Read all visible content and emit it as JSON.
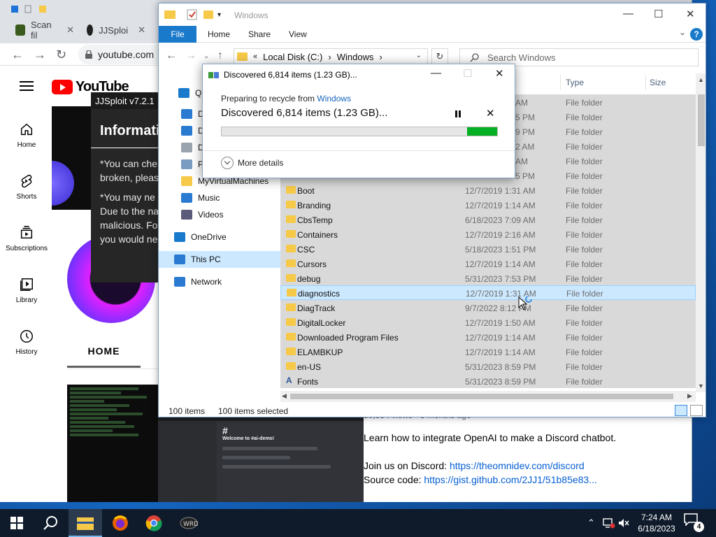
{
  "browser": {
    "tabs": [
      {
        "label": "Scan fil",
        "favicon_color": "#3a5a1e"
      },
      {
        "label": "JJSploi",
        "favicon_color": "#222222"
      }
    ],
    "url": "youtube.com"
  },
  "youtube": {
    "logo_text": "YouTube",
    "sidebar": [
      {
        "label": "Home",
        "icon": "home-icon"
      },
      {
        "label": "Shorts",
        "icon": "shorts-icon"
      },
      {
        "label": "Subscriptions",
        "icon": "subscriptions-icon"
      },
      {
        "label": "Library",
        "icon": "library-icon"
      },
      {
        "label": "History",
        "icon": "history-icon"
      }
    ],
    "channel_tab": "HOME",
    "video": {
      "views": "30,554 views • 3 months ago",
      "description": "Learn how to integrate OpenAI to make a Discord chatbot.",
      "discord_prefix": "Join us on Discord: ",
      "discord_link": "https://theomnidev.com/discord",
      "source_prefix": "Source code: ",
      "source_link": "https://gist.github.com/2JJ1/51b85e83...",
      "thumbnail_channel": "Welcome to #ai-demo!"
    }
  },
  "jjsploit": {
    "title": "JJSploit v7.2.1",
    "heading": "Information",
    "line1a": "*You can che",
    "line1b": "broken, pleas",
    "line2a": "*You may ne",
    "line2b": "Due to the na",
    "line2c": "malicious. Fo",
    "line2d": "you would ne"
  },
  "explorer": {
    "title": "Windows",
    "ribbon": {
      "file": "File",
      "home": "Home",
      "share": "Share",
      "view": "View",
      "help": "?"
    },
    "address": {
      "root": "Local Disk (C:)",
      "folder": "Windows",
      "sep": "›"
    },
    "search_placeholder": "Search Windows",
    "columns": {
      "type": "Type",
      "size": "Size"
    },
    "nav": [
      {
        "label": "Quick access",
        "icon": "star-icon",
        "color": "#1979ca"
      },
      {
        "label": "Desktop",
        "icon": "desktop-icon",
        "color": "#2a7ad2"
      },
      {
        "label": "Downloads",
        "icon": "download-icon",
        "color": "#2a7ad2"
      },
      {
        "label": "Documents",
        "icon": "documents-icon",
        "color": "#9aa4ae"
      },
      {
        "label": "Pictures",
        "icon": "pictures-icon",
        "color": "#7a9cc0"
      },
      {
        "label": "MyVirtualMachines",
        "icon": "folder-icon",
        "color": "#f7c948"
      },
      {
        "label": "Music",
        "icon": "music-icon",
        "color": "#2a7ad2"
      },
      {
        "label": "Videos",
        "icon": "videos-icon",
        "color": "#5a5a7a"
      },
      {
        "label": "OneDrive",
        "icon": "onedrive-icon",
        "color": "#1979ca"
      },
      {
        "label": "This PC",
        "icon": "this-pc-icon",
        "color": "#2a7ad2"
      },
      {
        "label": "Network",
        "icon": "network-icon",
        "color": "#2a7ad2"
      }
    ],
    "hidden_rows": [
      {
        "date": "AM",
        "type": "File folder"
      },
      {
        "date": "5 PM",
        "type": "File folder"
      },
      {
        "date": "9 PM",
        "type": "File folder"
      },
      {
        "date": "2 AM",
        "type": "File folder"
      },
      {
        "date": "AM",
        "type": "File folder"
      },
      {
        "date": "5 PM",
        "type": "File folder"
      }
    ],
    "rows": [
      {
        "name": "Boot",
        "date": "12/7/2019 1:31 AM",
        "type": "File folder"
      },
      {
        "name": "Branding",
        "date": "12/7/2019 1:14 AM",
        "type": "File folder"
      },
      {
        "name": "CbsTemp",
        "date": "6/18/2023 7:09 AM",
        "type": "File folder"
      },
      {
        "name": "Containers",
        "date": "12/7/2019 2:16 AM",
        "type": "File folder"
      },
      {
        "name": "CSC",
        "date": "5/18/2023 1:51 PM",
        "type": "File folder"
      },
      {
        "name": "Cursors",
        "date": "12/7/2019 1:14 AM",
        "type": "File folder"
      },
      {
        "name": "debug",
        "date": "5/31/2023 7:53 PM",
        "type": "File folder"
      },
      {
        "name": "diagnostics",
        "date": "12/7/2019 1:31 AM",
        "type": "File folder",
        "focus": true
      },
      {
        "name": "DiagTrack",
        "date": "9/7/2022 8:12 PM",
        "type": "File folder"
      },
      {
        "name": "DigitalLocker",
        "date": "12/7/2019 1:50 AM",
        "type": "File folder"
      },
      {
        "name": "Downloaded Program Files",
        "date": "12/7/2019 1:14 AM",
        "type": "File folder"
      },
      {
        "name": "ELAMBKUP",
        "date": "12/7/2019 1:14 AM",
        "type": "File folder"
      },
      {
        "name": "en-US",
        "date": "5/31/2023 8:59 PM",
        "type": "File folder"
      },
      {
        "name": "Fonts",
        "date": "5/31/2023 8:59 PM",
        "type": "File folder",
        "font": true
      }
    ],
    "status": {
      "items": "100 items",
      "selected": "100 items selected"
    }
  },
  "dialog": {
    "title": "Discovered 6,814 items (1.23 GB)...",
    "subtitle_prefix": "Preparing to recycle from ",
    "subtitle_link": "Windows",
    "status": "Discovered 6,814 items (1.23 GB)...",
    "progress_fraction": 0.11,
    "more_details": "More details",
    "progress_color": "#06b025"
  },
  "taskbar": {
    "apps": [
      {
        "name": "file-explorer",
        "active": true
      },
      {
        "name": "firefox",
        "active": false
      },
      {
        "name": "chrome",
        "active": false
      },
      {
        "name": "jjsploit",
        "active": false
      }
    ],
    "time": "7:24 AM",
    "date": "6/18/2023",
    "notifications": "4"
  }
}
